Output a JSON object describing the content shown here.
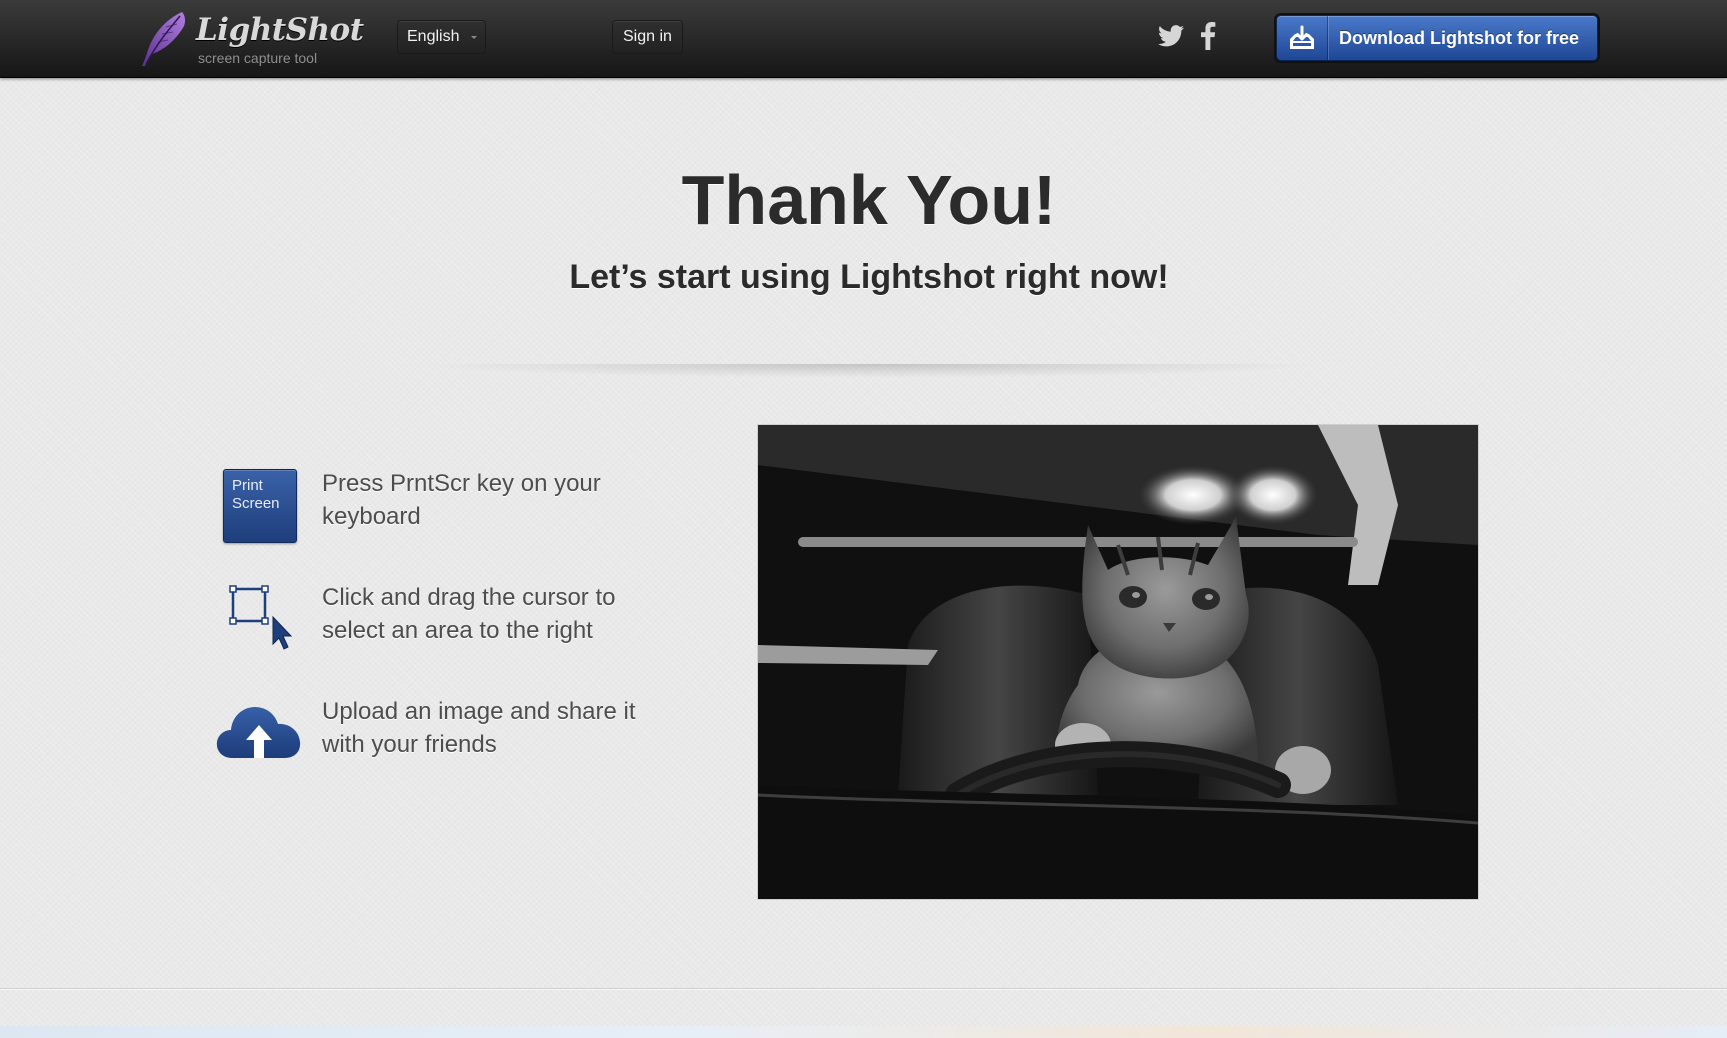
{
  "header": {
    "logo_title": "LightShot",
    "logo_tagline": "screen capture tool",
    "language": "English",
    "sign_in": "Sign in",
    "download_label": "Download Lightshot for free",
    "social": [
      "twitter-icon",
      "facebook-icon"
    ]
  },
  "hero": {
    "title": "Thank You!",
    "subtitle": "Let’s start using Lightshot right now!"
  },
  "steps": [
    {
      "icon": "print-screen-key-icon",
      "key_label": "Print\nScreen",
      "text": "Press PrntScr key on your keyboard"
    },
    {
      "icon": "select-area-cursor-icon",
      "text": "Click and drag the cursor to select an area to the right"
    },
    {
      "icon": "cloud-upload-icon",
      "text": "Upload an image and share it with your friends"
    }
  ],
  "colors": {
    "accent_blue": "#2a55a8",
    "header_dark": "#222222",
    "page_bg": "#e9e9e9",
    "heading_text": "#2b2b2b",
    "body_text": "#4d4d4d"
  }
}
